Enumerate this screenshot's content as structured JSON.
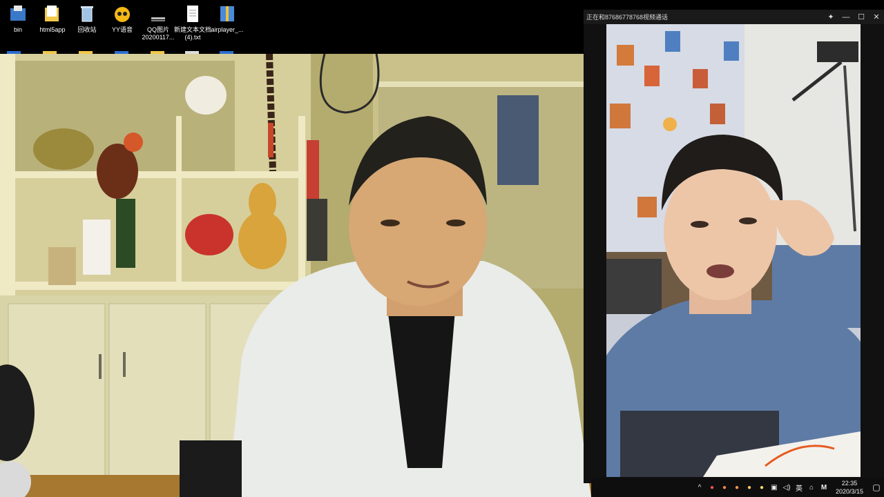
{
  "desktop": {
    "icons": [
      {
        "label": "bin",
        "icon": "bin-folder-icon",
        "color": "#3a78c9"
      },
      {
        "label": "html5app",
        "icon": "folder-icon",
        "color": "#f2c84b"
      },
      {
        "label": "回收站",
        "icon": "recycle-bin-icon",
        "color": "#9fc4e6"
      },
      {
        "label": "YY语音",
        "icon": "yy-voice-icon",
        "color": "#f5b915"
      },
      {
        "label": "QQ图片20200117...",
        "icon": "image-file-icon",
        "color": "#222222"
      },
      {
        "label": "新建文本文档(4).txt",
        "icon": "text-file-icon",
        "color": "#ffffff"
      },
      {
        "label": "airplayer_...",
        "icon": "archive-icon",
        "color": "#4a8ad8"
      }
    ]
  },
  "call": {
    "title": "正在和87686778768视频通话",
    "pin_icon": "pin-icon",
    "minimize_icon": "minimize-icon",
    "maximize_icon": "maximize-icon",
    "close_icon": "close-icon"
  },
  "taskbar": {
    "ime": "英",
    "time": "22:35",
    "date": "2020/3/15",
    "tray_icons": [
      "chevron-up-icon",
      "app-icon",
      "app-icon",
      "app-icon",
      "app-icon",
      "app-icon",
      "network-icon",
      "volume-icon"
    ],
    "ime_m": "M"
  }
}
